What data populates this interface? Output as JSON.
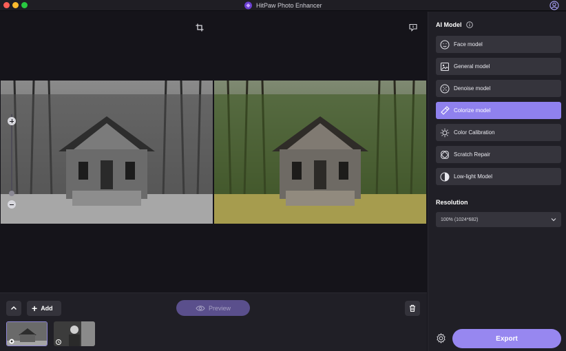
{
  "window": {
    "title": "HitPaw Photo Enhancer"
  },
  "colors": {
    "accent": "#8f81ee",
    "export": "#9787f0",
    "panel": "#201f26",
    "button": "#35343c"
  },
  "toolbar": {
    "add_label": "Add",
    "preview_label": "Preview"
  },
  "sidebar": {
    "ai_model_title": "AI Model",
    "models": [
      {
        "label": "Face model",
        "icon": "face-icon"
      },
      {
        "label": "General model",
        "icon": "image-icon"
      },
      {
        "label": "Denoise model",
        "icon": "denoise-icon"
      },
      {
        "label": "Colorize model",
        "icon": "colorize-icon",
        "selected": true
      },
      {
        "label": "Color Calibration",
        "icon": "sun-icon"
      },
      {
        "label": "Scratch Repair",
        "icon": "bandage-icon"
      },
      {
        "label": "Low-light Model",
        "icon": "half-circle-icon"
      }
    ],
    "resolution_title": "Resolution",
    "resolution_value": "100% (1024*682)",
    "export_label": "Export"
  }
}
